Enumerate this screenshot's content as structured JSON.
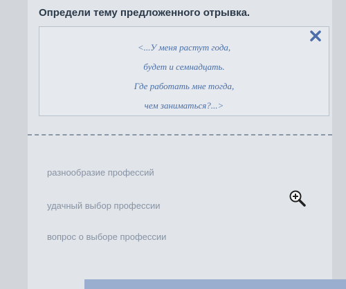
{
  "question": {
    "title": "Определи тему предложенного отрывка."
  },
  "excerpt": {
    "lines": [
      "<...У меня растут года,",
      "будет и семнадцать.",
      "Где работать мне тогда,",
      "чем заниматься?...>"
    ]
  },
  "options": [
    "разнообразие профессий",
    "удачный выбор профессии",
    "вопрос о выборе профессии"
  ],
  "icons": {
    "close": "close-icon",
    "zoom": "zoom-in-icon"
  },
  "colors": {
    "title": "#2b3a4a",
    "poem": "#4a6fa8",
    "option": "#8793a5",
    "close": "#4b6ea9"
  }
}
